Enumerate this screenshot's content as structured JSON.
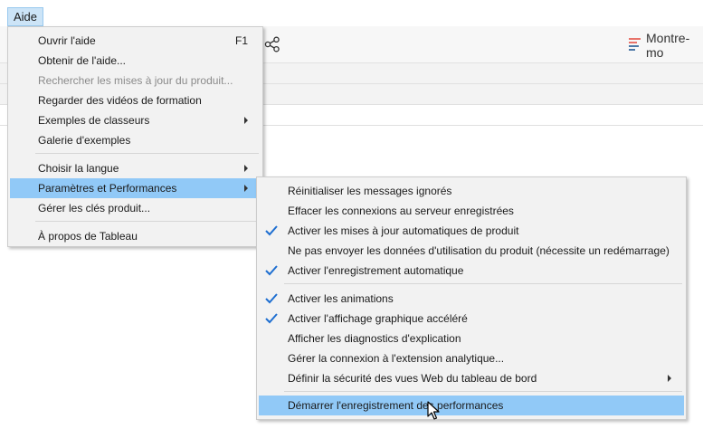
{
  "menubar": {
    "aide_label": "Aide"
  },
  "toolbar": {
    "show_me_label": "Montre-mo"
  },
  "main_menu": {
    "items": [
      {
        "label": "Ouvrir l'aide",
        "shortcut": "F1"
      },
      {
        "label": "Obtenir de l'aide..."
      },
      {
        "label": "Rechercher les mises à jour du produit..."
      },
      {
        "label": "Regarder des vidéos de formation"
      },
      {
        "label": "Exemples de classeurs"
      },
      {
        "label": "Galerie d'exemples"
      },
      {
        "label": "Choisir la langue"
      },
      {
        "label": "Paramètres et Performances"
      },
      {
        "label": "Gérer les clés produit..."
      },
      {
        "label": "À propos de Tableau"
      }
    ]
  },
  "sub_menu": {
    "items": [
      {
        "label": "Réinitialiser les messages ignorés"
      },
      {
        "label": "Effacer les connexions au serveur enregistrées"
      },
      {
        "label": "Activer les mises à jour automatiques de produit",
        "checked": true
      },
      {
        "label": "Ne pas envoyer les données d'utilisation du produit (nécessite un redémarrage)"
      },
      {
        "label": "Activer l'enregistrement automatique",
        "checked": true
      },
      {
        "label": "Activer les animations",
        "checked": true
      },
      {
        "label": "Activer l'affichage graphique accéléré",
        "checked": true
      },
      {
        "label": "Afficher les diagnostics d'explication"
      },
      {
        "label": "Gérer la connexion à l'extension analytique..."
      },
      {
        "label": "Définir la sécurité des vues Web du tableau de bord"
      },
      {
        "label": "Démarrer l'enregistrement des performances"
      }
    ]
  },
  "colors": {
    "highlight": "#91c9f7",
    "check": "#1f6fd1",
    "menu_bg": "#f2f2f2"
  }
}
